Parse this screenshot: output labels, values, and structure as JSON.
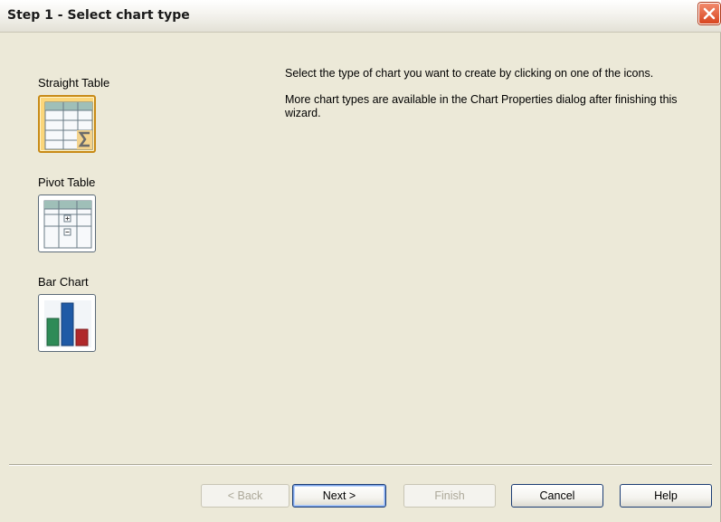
{
  "window": {
    "title": "Step 1 - Select chart type",
    "close_icon": "close-icon"
  },
  "chart_types": [
    {
      "label": "Straight Table",
      "icon": "straight-table-icon",
      "selected": true
    },
    {
      "label": "Pivot Table",
      "icon": "pivot-table-icon",
      "selected": false
    },
    {
      "label": "Bar Chart",
      "icon": "bar-chart-icon",
      "selected": false
    }
  ],
  "instructions": {
    "line1": "Select the type of chart you want to create by clicking on one of the icons.",
    "line2": "More chart types are available in the Chart Properties dialog after finishing this wizard."
  },
  "buttons": {
    "back": "< Back",
    "next": "Next >",
    "finish": "Finish",
    "cancel": "Cancel",
    "help": "Help"
  },
  "colors": {
    "selected_accent": "#fbd67a",
    "close_button": "#d8451f",
    "bar_green": "#2e8b57",
    "bar_blue": "#1f5aa6",
    "bar_red": "#b0282a"
  }
}
